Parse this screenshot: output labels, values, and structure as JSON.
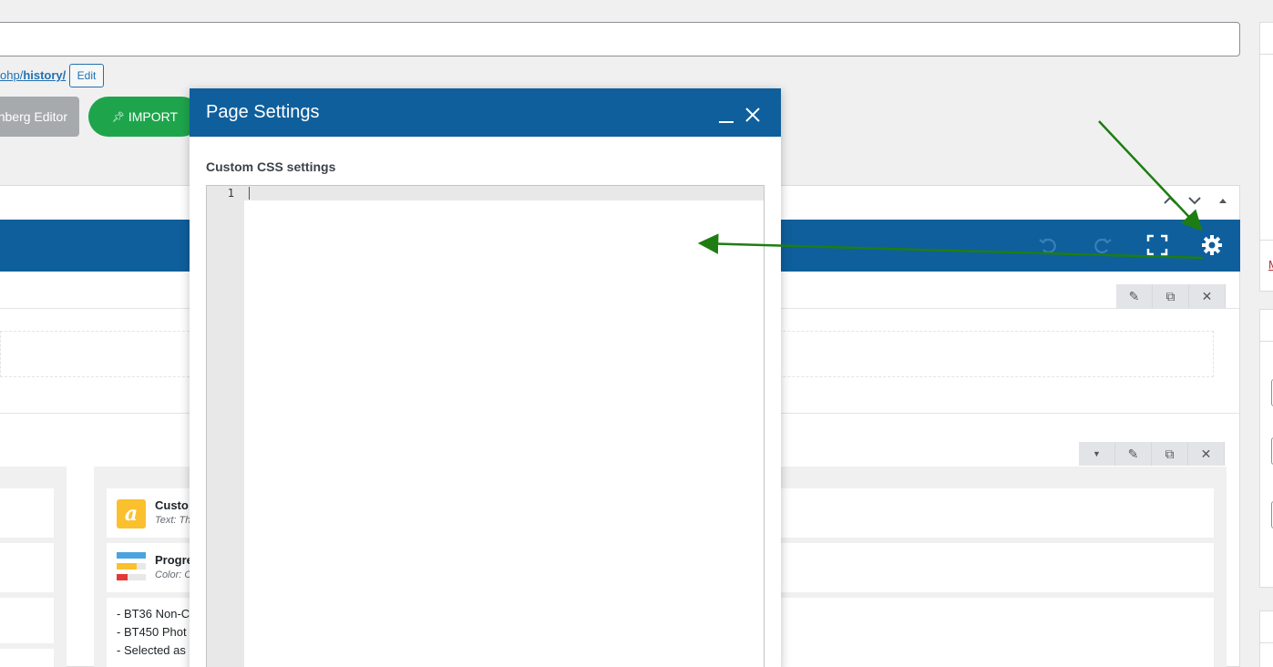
{
  "post": {
    "permalink_prefix": "ohp/",
    "permalink_slug": "history/",
    "edit_label": "Edit"
  },
  "toolbar": {
    "gutenberg_label": "nberg Editor",
    "import_label": "IMPORT"
  },
  "builder": {
    "elements": [
      {
        "title": "Custo",
        "subtitle": "Text: Th"
      },
      {
        "title": "Progre",
        "subtitle": "Color: C"
      }
    ],
    "text_lines": [
      "- BT36 Non-C",
      "- BT450 Phot",
      "- Selected as"
    ]
  },
  "modal": {
    "title": "Page Settings",
    "label": "Custom CSS settings",
    "line_number": "1"
  },
  "sidebar": {
    "link_text": "M"
  },
  "colors": {
    "brand_blue": "#0f5f9c",
    "import_green": "#1ea54c",
    "annotation_arrow": "#1e7d12"
  }
}
